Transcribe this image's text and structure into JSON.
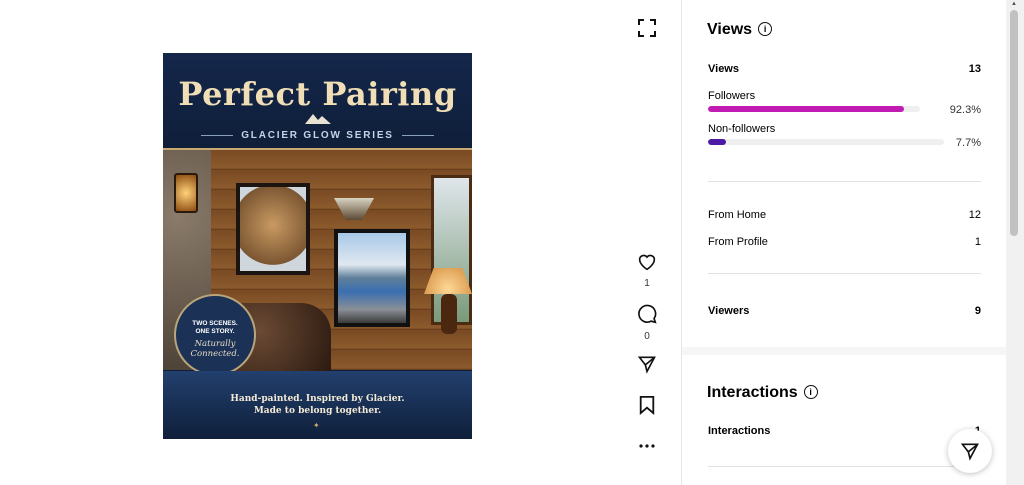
{
  "post": {
    "poster": {
      "title": "Perfect Pairing",
      "series": "GLACIER GLOW SERIES",
      "badge_line1": "TWO SCENES.",
      "badge_line2": "ONE STORY.",
      "badge_line3": "Naturally",
      "badge_line4": "Connected.",
      "footer_line1": "Hand-painted.  Inspired by Glacier.",
      "footer_line2": "Made to belong together."
    },
    "actions": {
      "like_count": "1",
      "comment_count": "0"
    },
    "icons": [
      "expand-icon",
      "heart-icon",
      "comment-icon",
      "share-icon",
      "bookmark-icon",
      "more-icon"
    ]
  },
  "insights": {
    "views_section": {
      "title": "Views",
      "views_label": "Views",
      "views_value": "13",
      "followers_label": "Followers",
      "followers_pct": "92.3%",
      "followers_fraction": 0.923,
      "nonfollowers_label": "Non-followers",
      "nonfollowers_pct": "7.7%",
      "nonfollowers_fraction": 0.077,
      "from_home_label": "From Home",
      "from_home_value": "12",
      "from_profile_label": "From Profile",
      "from_profile_value": "1",
      "viewers_label": "Viewers",
      "viewers_value": "9"
    },
    "interactions_section": {
      "title": "Interactions",
      "interactions_label": "Interactions",
      "interactions_value": "1"
    }
  },
  "colors": {
    "followers_bar": "#c21bb4",
    "nonfollowers_bar": "#4a1aa6",
    "track": "#efefef"
  }
}
